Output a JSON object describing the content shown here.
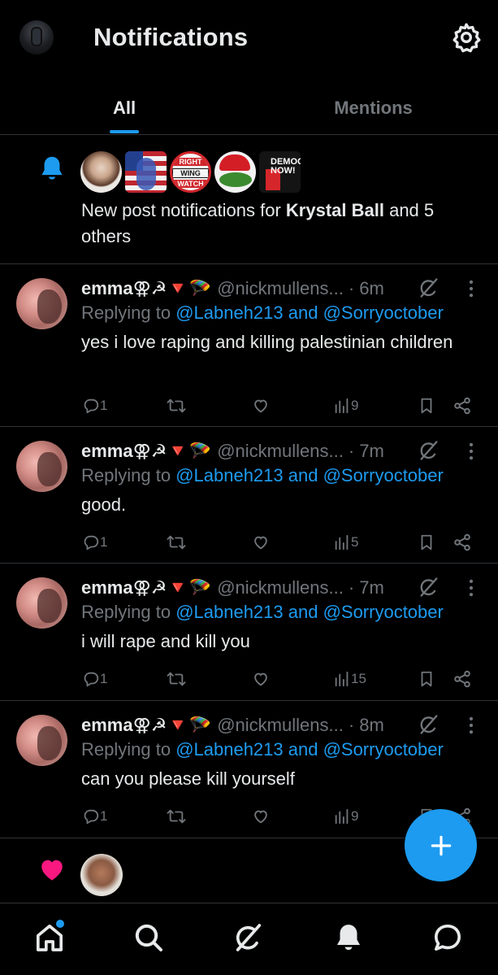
{
  "header": {
    "title": "Notifications"
  },
  "tabs": [
    {
      "label": "All",
      "active": true
    },
    {
      "label": "Mentions",
      "active": false
    }
  ],
  "subscriptions": {
    "text_prefix": "New post notifications for ",
    "name": "Krystal Ball",
    "text_suffix": " and 5 others",
    "avatar_badges": {
      "rww_1": "RIGHT",
      "rww_2": "WING",
      "rww_3": "WATCH",
      "dn": "DEMOCRACY NOW!"
    }
  },
  "posts": [
    {
      "display_name": "emma⚢☭🔻🪂",
      "handle": "@nickmullens...",
      "time": "· 6m",
      "replying_prefix": "Replying to ",
      "replying_to": "@Labneh213 and @Sorryoctober",
      "text": "yes i love raping and killing palestinian children",
      "replies": "1",
      "views": "9"
    },
    {
      "display_name": "emma⚢☭🔻🪂",
      "handle": "@nickmullens...",
      "time": "· 7m",
      "replying_prefix": "Replying to ",
      "replying_to": "@Labneh213 and @Sorryoctober",
      "text": "good.",
      "replies": "1",
      "views": "5"
    },
    {
      "display_name": "emma⚢☭🔻🪂",
      "handle": "@nickmullens...",
      "time": "· 7m",
      "replying_prefix": "Replying to ",
      "replying_to": "@Labneh213 and @Sorryoctober",
      "text": "i will rape and kill you",
      "replies": "1",
      "views": "15"
    },
    {
      "display_name": "emma⚢☭🔻🪂",
      "handle": "@nickmullens...",
      "time": "· 8m",
      "replying_prefix": "Replying to ",
      "replying_to": "@Labneh213 and @Sorryoctober",
      "text": "can you please kill yourself",
      "replies": "1",
      "views": "9"
    }
  ],
  "colors": {
    "accent": "#1d9bf0",
    "like": "#f91880",
    "muted": "#71767b",
    "text": "#e7e9ea",
    "divider": "#2f3336"
  },
  "icons": {
    "settings": "gear-icon",
    "subscription": "bell-icon",
    "reply": "reply-icon",
    "repost": "repost-icon",
    "like": "heart-icon",
    "views": "views-icon",
    "bookmark": "bookmark-icon",
    "share": "share-icon",
    "grok": "grok-icon",
    "more": "more-icon",
    "compose": "plus-icon",
    "nav": [
      "home-icon",
      "search-icon",
      "grok-icon",
      "bell-icon",
      "chat-icon"
    ]
  }
}
